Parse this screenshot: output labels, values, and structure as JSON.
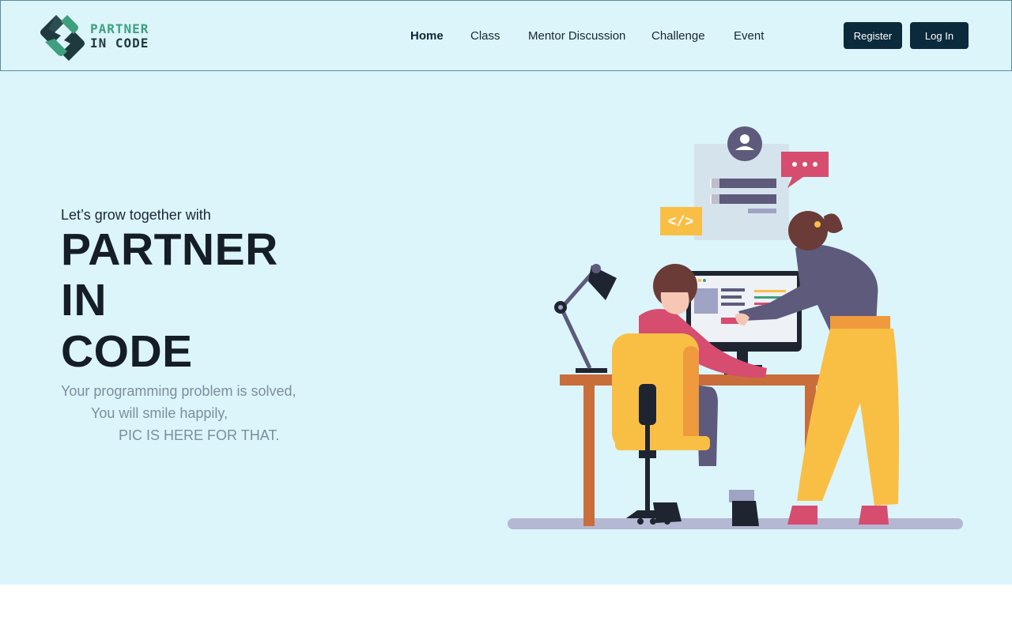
{
  "brand": {
    "line1": "PARTNER",
    "line2": "IN CODE",
    "colors": {
      "green": "#3fa07e",
      "dark": "#1f3a3f"
    }
  },
  "nav": {
    "items": [
      {
        "label": "Home",
        "active": true
      },
      {
        "label": "Class",
        "active": false
      },
      {
        "label": "Mentor Discussion",
        "active": false
      },
      {
        "label": "Challenge",
        "active": false
      },
      {
        "label": "Event",
        "active": false
      }
    ],
    "register_label": "Register",
    "login_label": "Log In"
  },
  "hero": {
    "tagline": "Let’s grow together with",
    "title_lines": [
      "PARTNER",
      "IN",
      "CODE"
    ],
    "subtitle_lines": [
      "Your programming problem is solved,",
      "You will smile happily,",
      "PIC IS HERE FOR THAT."
    ],
    "illustration_icon": "developers-at-desk-illustration",
    "code_badge": "</>"
  },
  "colors": {
    "hero_bg": "#dbf5fb",
    "button_bg": "#0b2a3c",
    "title": "#151d27",
    "subtitle": "#7d8e99"
  }
}
